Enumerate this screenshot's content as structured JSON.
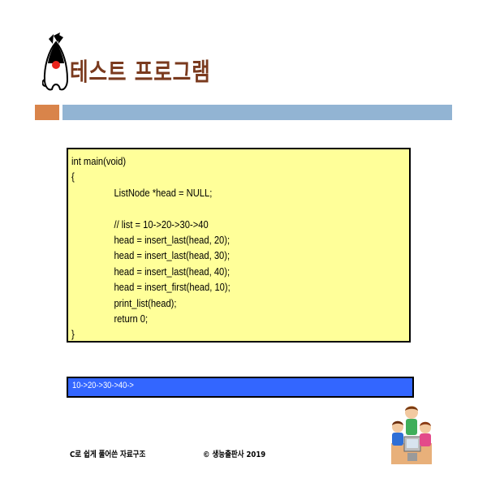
{
  "header": {
    "title": "테스트 프로그램",
    "logo_icon": "duke-mascot-icon",
    "accent_colors": {
      "title": "#7a3a1e",
      "orange_bar": "#d9844a",
      "blue_bar": "#92b4d3"
    }
  },
  "code": {
    "background": "#ffff99",
    "lines": [
      "int main(void)",
      "{",
      "ListNode *head = NULL;",
      "",
      "// list = 10->20->30->40",
      "head = insert_last(head, 20);",
      "head = insert_last(head, 30);",
      "head = insert_last(head, 40);",
      "head = insert_first(head, 10);",
      "print_list(head);",
      "return 0;",
      "}"
    ]
  },
  "output": {
    "background": "#3366ff",
    "text": "10->20->30->40->"
  },
  "footer": {
    "book": "C로 쉽게 풀어쓴 자료구조",
    "copyright": "© 생능출판사 2019",
    "illustration_icon": "kids-at-computer-icon"
  }
}
